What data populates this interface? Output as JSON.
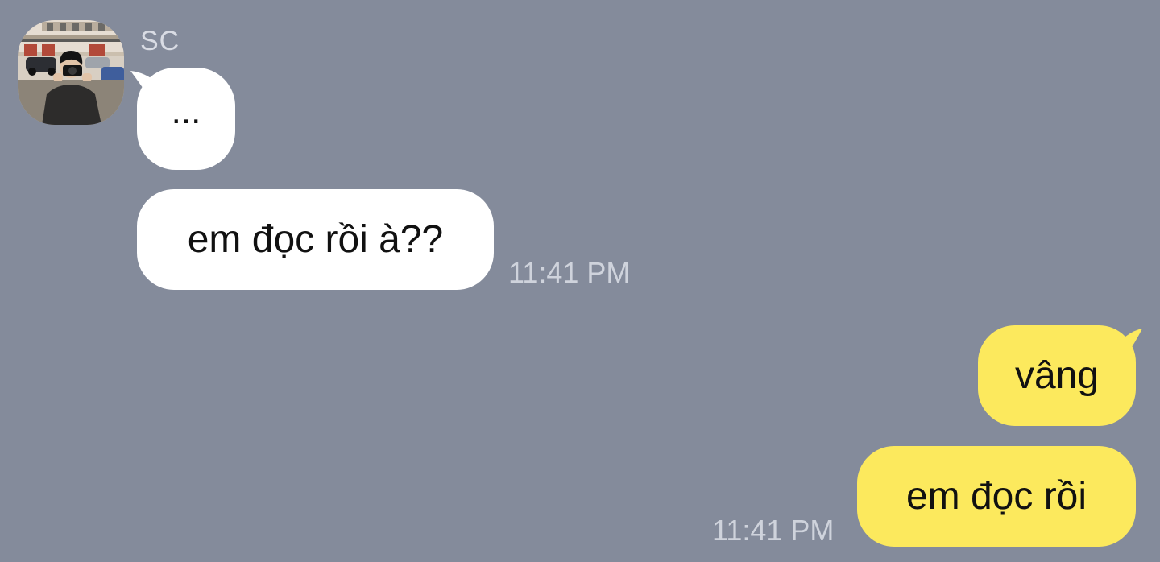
{
  "conversation": {
    "contact": {
      "name": "SC",
      "avatar": "profile-photo"
    },
    "messages": [
      {
        "direction": "incoming",
        "text": "..."
      },
      {
        "direction": "incoming",
        "text": "em đọc rồi à??",
        "time": "11:41 PM"
      },
      {
        "direction": "outgoing",
        "text": "vâng"
      },
      {
        "direction": "outgoing",
        "text": "em đọc rồi",
        "time": "11:41 PM"
      }
    ]
  },
  "colors": {
    "background": "#848b9b",
    "incoming_bubble": "#ffffff",
    "outgoing_bubble": "#fce95d",
    "timestamp": "#cfd3dc",
    "sender_name": "#d9dce4"
  }
}
